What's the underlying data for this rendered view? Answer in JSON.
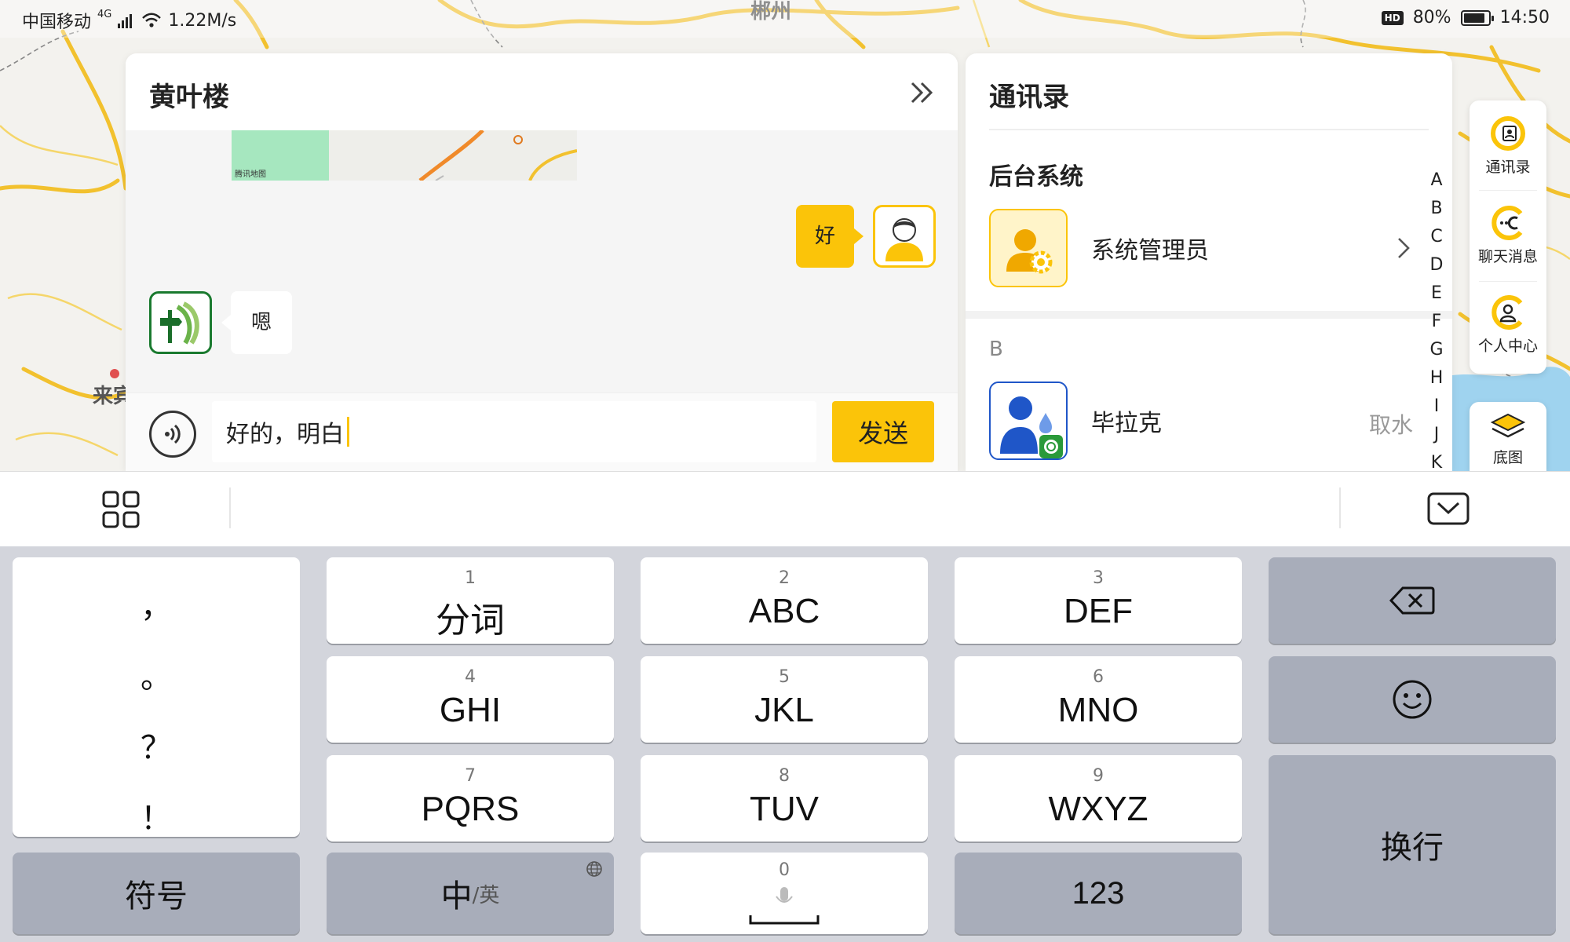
{
  "status_bar": {
    "carrier": "中国移动",
    "network": "4G",
    "speed": "1.22M/s",
    "hd": "HD",
    "battery": "80%",
    "time": "14:50"
  },
  "map": {
    "labels": [
      "郴州",
      "来宾"
    ]
  },
  "chat": {
    "title": "黄叶楼",
    "map_logo": "腾讯地图",
    "messages": [
      {
        "side": "right",
        "text": "好"
      },
      {
        "side": "left",
        "text": "嗯"
      }
    ],
    "input_value": "好的，明白",
    "send_label": "发送"
  },
  "contacts": {
    "title": "通讯录",
    "section": "后台系统",
    "admin": {
      "name": "系统管理员"
    },
    "letter_b": "B",
    "contact_b": {
      "name": "毕拉克",
      "tag": "取水"
    },
    "alpha_index": [
      "A",
      "B",
      "C",
      "D",
      "E",
      "F",
      "G",
      "H",
      "I",
      "J",
      "K"
    ]
  },
  "right_nav": {
    "items": [
      "通讯录",
      "聊天消息",
      "个人中心"
    ],
    "layer_label": "底图"
  },
  "keyboard": {
    "punct": [
      "，",
      "。",
      "？",
      "！"
    ],
    "keys": [
      {
        "num": "1",
        "label": "分词"
      },
      {
        "num": "2",
        "label": "ABC"
      },
      {
        "num": "3",
        "label": "DEF"
      },
      {
        "num": "4",
        "label": "GHI"
      },
      {
        "num": "5",
        "label": "JKL"
      },
      {
        "num": "6",
        "label": "MNO"
      },
      {
        "num": "7",
        "label": "PQRS"
      },
      {
        "num": "8",
        "label": "TUV"
      },
      {
        "num": "9",
        "label": "WXYZ"
      }
    ],
    "symbol_label": "符号",
    "lang_main": "中",
    "lang_sub": "/英",
    "zero_num": "0",
    "num_label": "123",
    "enter_label": "换行"
  },
  "colors": {
    "accent": "#fbc409",
    "map_road": "#f2c12e",
    "key_dark": "#a8adba",
    "keyboard_bg": "#d3d5dc"
  }
}
